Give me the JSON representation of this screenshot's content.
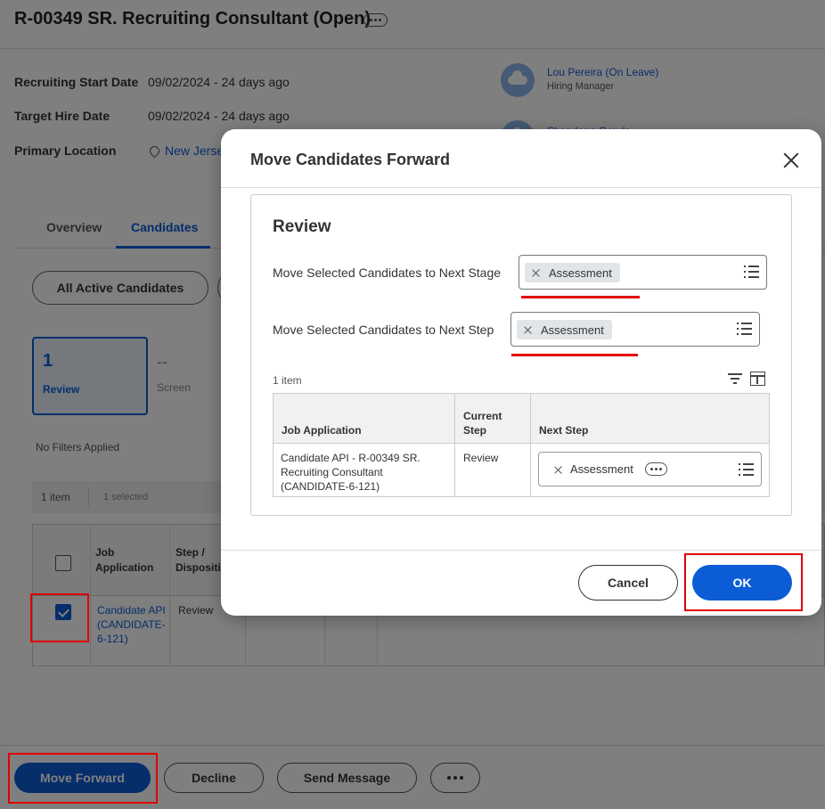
{
  "page": {
    "title": "R-00349 SR. Recruiting Consultant (Open)",
    "fields": [
      {
        "label": "Recruiting Start Date",
        "value": "09/02/2024 - 24 days ago"
      },
      {
        "label": "Target Hire Date",
        "value": "09/02/2024 - 24 days ago"
      },
      {
        "label": "Primary Location",
        "value": "New Jerse"
      }
    ],
    "people": [
      {
        "name": "Lou Pereira (On Leave)",
        "role": "Hiring Manager"
      },
      {
        "name": "Shandana Gouda"
      }
    ],
    "tabs": [
      "Overview",
      "Candidates"
    ],
    "filter_buttons": [
      "All Active Candidates"
    ],
    "stages": [
      {
        "count": "1",
        "label": "Review"
      },
      {
        "count": "--",
        "label": "Screen"
      }
    ],
    "filter_status": "No Filters Applied",
    "item_count": "1 item",
    "selected_count": "1 selected",
    "table": {
      "headers": [
        "Job Application",
        "Step / Dispositio"
      ],
      "rows": [
        {
          "application": "Candidate API (CANDIDATE-6-121)",
          "step": "Review"
        }
      ]
    },
    "footer_buttons": {
      "move_forward": "Move Forward",
      "decline": "Decline",
      "send_message": "Send Message"
    }
  },
  "modal": {
    "title": "Move Candidates Forward",
    "section_heading": "Review",
    "next_stage_label": "Move Selected Candidates to Next Stage",
    "next_stage_value": "Assessment",
    "next_step_label": "Move Selected Candidates to Next Step",
    "next_step_value": "Assessment",
    "item_count": "1 item",
    "grid": {
      "headers": [
        "Job Application",
        "Current Step",
        "Next Step"
      ],
      "rows": [
        {
          "application": "Candidate API - R-00349 SR. Recruiting Consultant (CANDIDATE-6-121)",
          "current_step": "Review",
          "next_step": "Assessment"
        }
      ]
    },
    "cancel_label": "Cancel",
    "ok_label": "OK"
  },
  "colors": {
    "accent": "#0b5cd5",
    "highlight": "#e10000"
  }
}
